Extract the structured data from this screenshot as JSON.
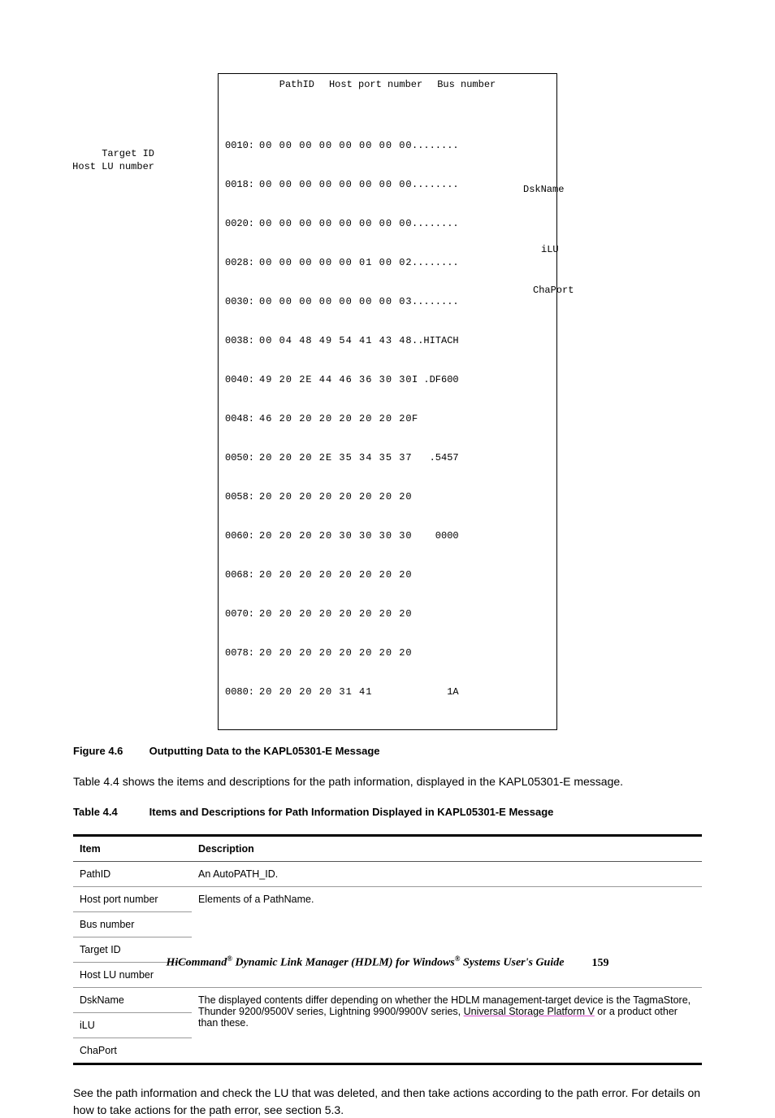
{
  "diagram": {
    "topLabels": {
      "pathId": "PathID",
      "hostPort": "Host port number",
      "bus": "Bus number"
    },
    "leftLabels": {
      "targetId": "Target ID",
      "hostLu": "Host LU number"
    },
    "rightLabels": {
      "dskName": "DskName",
      "ilu": "iLU",
      "chaPort": "ChaPort"
    },
    "ascii": {
      "dots": "........",
      "hitach": "..HITACH",
      "df600": "I .DF600",
      "f": "F",
      "n5457": ".5457",
      "n0000": "0000",
      "n1a": "1A"
    },
    "rows": [
      {
        "addr": "0010:",
        "b": "00 00 00 00 00 00 00 00",
        "a": "........"
      },
      {
        "addr": "0018:",
        "b": "00 00 00 00 00 00 00 00",
        "a": "........"
      },
      {
        "addr": "0020:",
        "b": "00 00 00 00 00 00 00 00",
        "a": "........"
      },
      {
        "addr": "0028:",
        "b": "00 00 00 00 00 01 00 02",
        "a": "........"
      },
      {
        "addr": "0030:",
        "b": "00 00 00 00 00 00 00 03",
        "a": "........"
      },
      {
        "addr": "0038:",
        "b": "00 04 48 49 54 41 43 48",
        "a": "..HITACH"
      },
      {
        "addr": "0040:",
        "b": "49 20 2E 44 46 36 30 30",
        "a": "I .DF600"
      },
      {
        "addr": "0048:",
        "b": "46 20 20 20 20 20 20 20",
        "a": "F"
      },
      {
        "addr": "0050:",
        "b": "20 20 20 2E 35 34 35 37",
        "a": "   .5457"
      },
      {
        "addr": "0058:",
        "b": "20 20 20 20 20 20 20 20",
        "a": ""
      },
      {
        "addr": "0060:",
        "b": "20 20 20 20 30 30 30 30",
        "a": "    0000"
      },
      {
        "addr": "0068:",
        "b": "20 20 20 20 20 20 20 20",
        "a": ""
      },
      {
        "addr": "0070:",
        "b": "20 20 20 20 20 20 20 20",
        "a": ""
      },
      {
        "addr": "0078:",
        "b": "20 20 20 20 20 20 20 20",
        "a": ""
      },
      {
        "addr": "0080:",
        "b": "20 20 20 20 31 41",
        "a": "      1A"
      }
    ]
  },
  "figCaption": {
    "num": "Figure 4.6",
    "text": "Outputting Data to the KAPL05301-E Message"
  },
  "para1": "Table 4.4 shows the items and descriptions for the path information, displayed in the KAPL05301-E message.",
  "tabCaption": {
    "num": "Table 4.4",
    "text": "Items and Descriptions for Path Information Displayed in KAPL05301-E Message"
  },
  "table": {
    "h1": "Item",
    "h2": "Description",
    "rows": {
      "r1c1": "PathID",
      "r1c2": "An AutoPATH_ID.",
      "r2c1": "Host port number",
      "r2c2": "Elements of a PathName.",
      "r3c1": "Bus number",
      "r4c1": "Target ID",
      "r5c1": "Host LU number",
      "r6c1": "DskName",
      "r6c2a": "The displayed contents differ depending on whether the HDLM management-target device is the TagmaStore, Thunder 9200/9500V series, Lightning 9900/9900V series, ",
      "r6c2link": "Universal Storage Platform V",
      "r6c2b": " or a product other than these.",
      "r7c1": "iLU",
      "r8c1": "ChaPort"
    }
  },
  "para2": "See the path information and check the LU that was deleted, and then take actions according to the path error. For details on how to take actions for the path error, see section 5.3.",
  "footer": {
    "brand": "HiCommand",
    "reg": "®",
    "mid1": " Dynamic Link Manager (HDLM) for Windows",
    "mid2": " Systems User's Guide",
    "page": "159"
  }
}
